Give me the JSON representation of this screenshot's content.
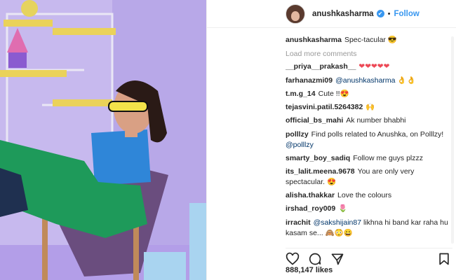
{
  "header": {
    "username": "anushkasharma",
    "follow_label": "Follow",
    "separator": "•",
    "verified_mark": "✔"
  },
  "caption": {
    "user": "anushkasharma",
    "text": "Spec-tacular 😎"
  },
  "load_more": "Load more comments",
  "comments": [
    {
      "user": "__priya__prakash__",
      "text": "❤❤❤❤❤"
    },
    {
      "user": "farhanazmi09",
      "mention": "@anushkasharma",
      "text": "👌👌"
    },
    {
      "user": "t.m.g_14",
      "text": "Cute !!😍"
    },
    {
      "user": "tejasvini.patil.5264382",
      "text": "🙌"
    },
    {
      "user": "official_bs_mahi",
      "text": "Ak number bhabhi"
    },
    {
      "user": "polllzy",
      "text": "Find polls related to Anushka, on Polllzy!",
      "mention": "@polllzy"
    },
    {
      "user": "smarty_boy_sadiq",
      "text": "Follow me guys plzzz"
    },
    {
      "user": "its_lalit.meena.9678",
      "text": "You are only very spectacular. 😍"
    },
    {
      "user": "alisha.thakkar",
      "text": "Love the colours"
    },
    {
      "user": "irshad_roy009",
      "text": "🌷"
    },
    {
      "user": "irrachit",
      "mention": "@sakshijain87",
      "text": "likhna hi band kar raha hu kasam se... 🙈😳😀"
    }
  ],
  "likes": "888,147 likes",
  "icons": [
    "heart-icon",
    "comment-icon",
    "share-icon",
    "bookmark-icon"
  ],
  "colors": {
    "accent": "#3897f0",
    "text": "#262626",
    "muted": "#999999",
    "photo_bg": "#b7a9e6"
  }
}
